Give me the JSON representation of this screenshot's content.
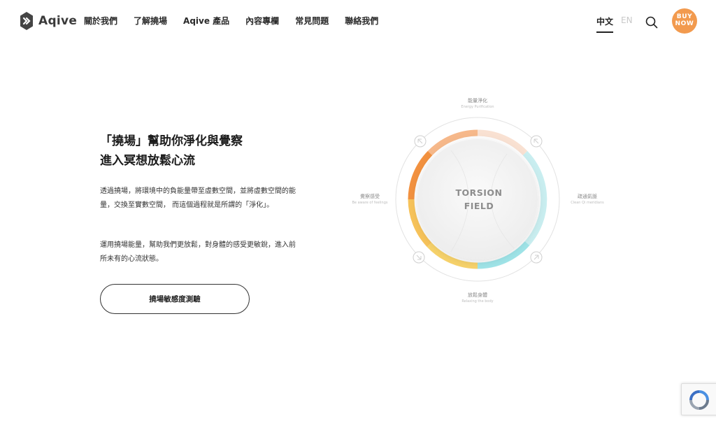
{
  "brand": {
    "name": "Aqive"
  },
  "nav": {
    "items": [
      {
        "label": "關於我們"
      },
      {
        "label": "了解撓場"
      },
      {
        "label": "Aqive 產品"
      },
      {
        "label": "內容專欄"
      },
      {
        "label": "常見問題"
      },
      {
        "label": "聯絡我們"
      }
    ]
  },
  "lang": {
    "zh": "中文",
    "en": "EN"
  },
  "buy": {
    "line1": "BUY",
    "line2": "NOW"
  },
  "hero": {
    "headline_line1": "「撓場」幫助你淨化與覺察",
    "headline_line2": "進入冥想放鬆心流",
    "paragraph1": "透過撓場，將環境中的負能量帶至虛數空間，並將虛數空間的能量，交換至實數空間， 而這個過程就是所謂的「淨化」。",
    "paragraph2": "運用撓場能量，幫助我們更放鬆，對身體的感受更敏銳，進入前所未有的心流狀態。",
    "cta_label": "撓場敏感度測驗"
  },
  "diagram": {
    "center_line1": "TORSION",
    "center_line2": "FIELD",
    "labels": {
      "top": {
        "zh": "能量淨化",
        "en": "Energy Purification"
      },
      "right": {
        "zh": "疏通氣脈",
        "en": "Clean Qi meridians"
      },
      "bottom": {
        "zh": "放鬆身體",
        "en": "Relaxing the body"
      },
      "left": {
        "zh": "覺察感受",
        "en": "Be aware of feelings"
      }
    },
    "colors": {
      "orange": "#f2913f",
      "yellow": "#f7cf55",
      "cyan": "#9fe4e8",
      "peach": "#f6cdb0"
    }
  }
}
